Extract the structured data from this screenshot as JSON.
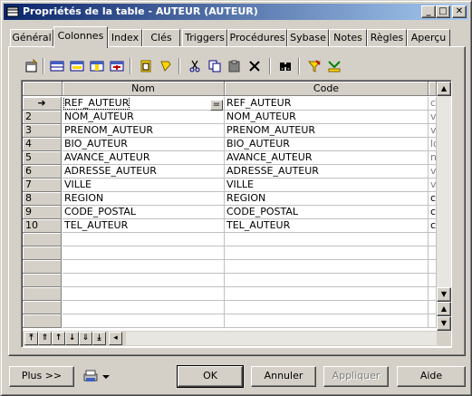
{
  "window": {
    "title": "Propriétés de la table - AUTEUR (AUTEUR)",
    "controls": {
      "minimize": "_",
      "maximize": "□",
      "close": "✕"
    }
  },
  "tabs": [
    {
      "label": "Général",
      "active": false
    },
    {
      "label": "Colonnes",
      "active": true
    },
    {
      "label": "Index",
      "active": false
    },
    {
      "label": "Clés",
      "active": false
    },
    {
      "label": "Triggers",
      "active": false
    },
    {
      "label": "Procédures",
      "active": false
    },
    {
      "label": "Sybase",
      "active": false
    },
    {
      "label": "Notes",
      "active": false
    },
    {
      "label": "Règles",
      "active": false
    },
    {
      "label": "Aperçu",
      "active": false
    }
  ],
  "toolbar": {
    "icons": [
      "properties-icon",
      "add-row-icon",
      "insert-row-icon",
      "add-columns-icon",
      "create-column-icon",
      "paste-icon",
      "find-icon",
      "cut-icon",
      "copy-icon",
      "paste-clip-icon",
      "delete-icon",
      "find-binoculars-icon",
      "filter-icon",
      "customize-columns-icon"
    ]
  },
  "grid": {
    "columns": [
      "Nom",
      "Code"
    ],
    "rows": [
      {
        "marker": "➜",
        "nom": "REF_AUTEUR",
        "code": "REF_AUTEUR",
        "extra": "cl"
      },
      {
        "marker": "2",
        "nom": "NOM_AUTEUR",
        "code": "NOM_AUTEUR",
        "extra": "va"
      },
      {
        "marker": "3",
        "nom": "PRENOM_AUTEUR",
        "code": "PRENOM_AUTEUR",
        "extra": "va"
      },
      {
        "marker": "4",
        "nom": "BIO_AUTEUR",
        "code": "BIO_AUTEUR",
        "extra": "lo"
      },
      {
        "marker": "5",
        "nom": "AVANCE_AUTEUR",
        "code": "AVANCE_AUTEUR",
        "extra": "nu"
      },
      {
        "marker": "6",
        "nom": "ADRESSE_AUTEUR",
        "code": "ADRESSE_AUTEUR",
        "extra": "va"
      },
      {
        "marker": "7",
        "nom": "VILLE",
        "code": "VILLE",
        "extra": "va"
      },
      {
        "marker": "8",
        "nom": "REGION",
        "code": "REGION",
        "extra": "ch"
      },
      {
        "marker": "9",
        "nom": "CODE_POSTAL",
        "code": "CODE_POSTAL",
        "extra": "ch"
      },
      {
        "marker": "10",
        "nom": "TEL_AUTEUR",
        "code": "TEL_AUTEUR",
        "extra": "ch"
      }
    ],
    "selected_cell_button": "="
  },
  "footer": {
    "plus_label": "Plus >>",
    "ok_label": "OK",
    "cancel_label": "Annuler",
    "apply_label": "Appliquer",
    "help_label": "Aide"
  }
}
